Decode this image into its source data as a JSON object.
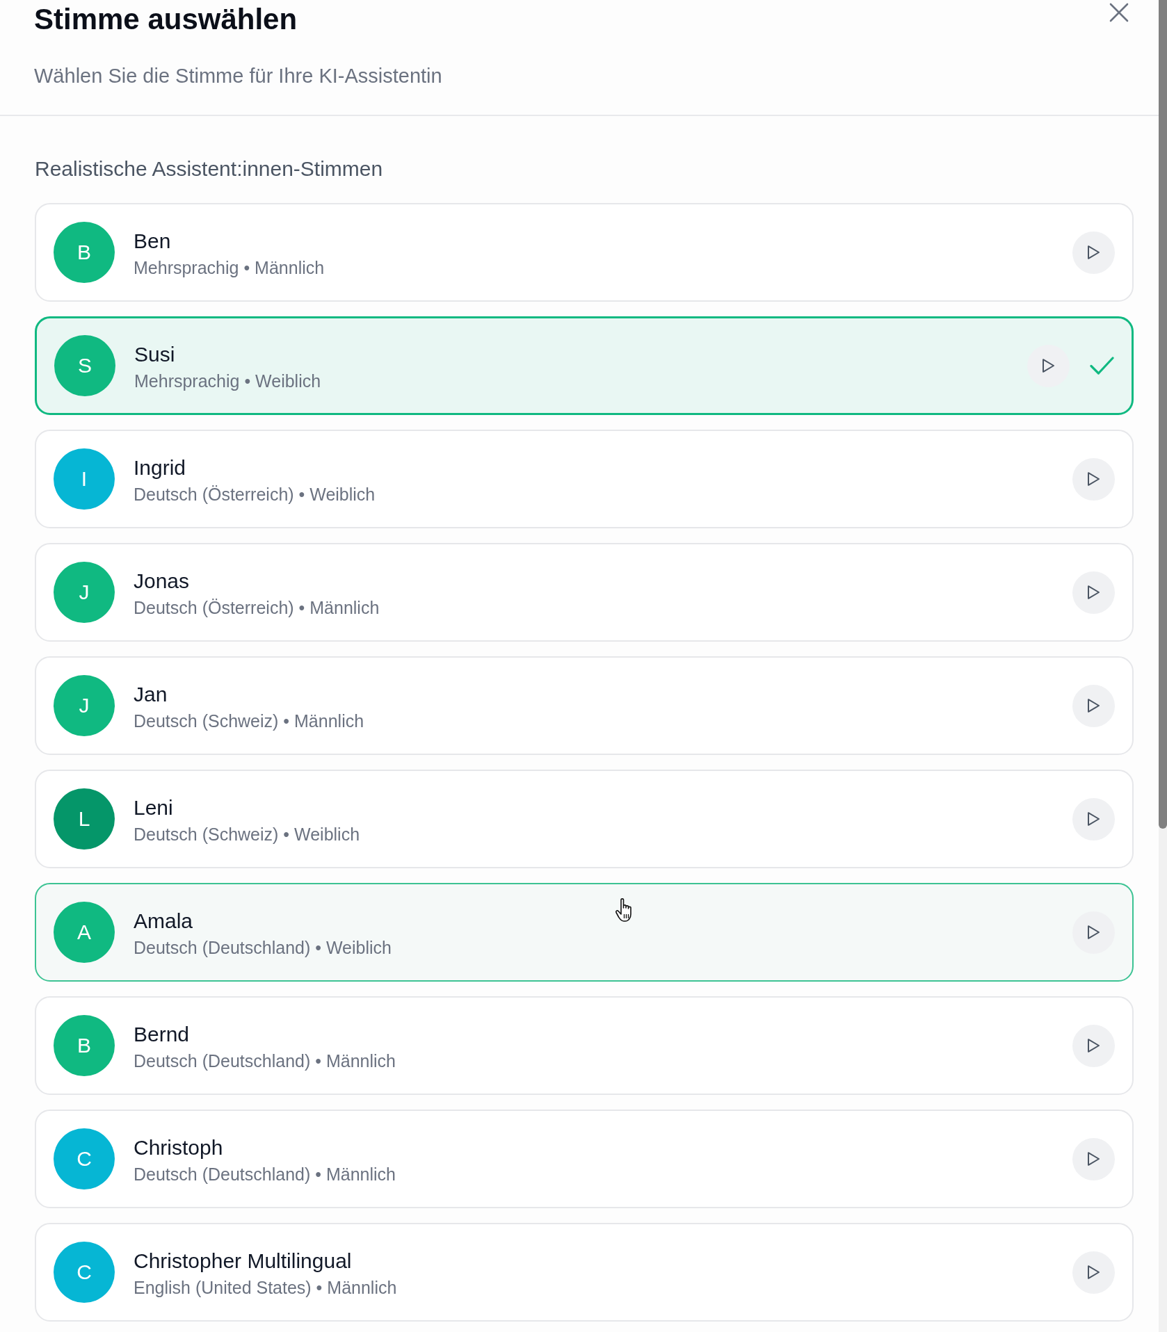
{
  "dialog": {
    "title": "Stimme auswählen",
    "subtitle": "Wählen Sie die Stimme für Ihre KI-Assistentin"
  },
  "section": {
    "heading": "Realistische Assistent:innen-Stimmen"
  },
  "voices": [
    {
      "initial": "B",
      "name": "Ben",
      "details": "Mehrsprachig • Männlich",
      "color": "#10b981",
      "selected": false,
      "hovered": false
    },
    {
      "initial": "S",
      "name": "Susi",
      "details": "Mehrsprachig • Weiblich",
      "color": "#10b981",
      "selected": true,
      "hovered": false
    },
    {
      "initial": "I",
      "name": "Ingrid",
      "details": "Deutsch (Österreich) • Weiblich",
      "color": "#06b6d4",
      "selected": false,
      "hovered": false
    },
    {
      "initial": "J",
      "name": "Jonas",
      "details": "Deutsch (Österreich) • Männlich",
      "color": "#10b981",
      "selected": false,
      "hovered": false
    },
    {
      "initial": "J",
      "name": "Jan",
      "details": "Deutsch (Schweiz) • Männlich",
      "color": "#10b981",
      "selected": false,
      "hovered": false
    },
    {
      "initial": "L",
      "name": "Leni",
      "details": "Deutsch (Schweiz) • Weiblich",
      "color": "#059669",
      "selected": false,
      "hovered": false
    },
    {
      "initial": "A",
      "name": "Amala",
      "details": "Deutsch (Deutschland) • Weiblich",
      "color": "#10b981",
      "selected": false,
      "hovered": true
    },
    {
      "initial": "B",
      "name": "Bernd",
      "details": "Deutsch (Deutschland) • Männlich",
      "color": "#10b981",
      "selected": false,
      "hovered": false
    },
    {
      "initial": "C",
      "name": "Christoph",
      "details": "Deutsch (Deutschland) • Männlich",
      "color": "#06b6d4",
      "selected": false,
      "hovered": false
    },
    {
      "initial": "C",
      "name": "Christopher Multilingual",
      "details": "English (United States) • Männlich",
      "color": "#06b6d4",
      "selected": false,
      "hovered": false
    }
  ]
}
